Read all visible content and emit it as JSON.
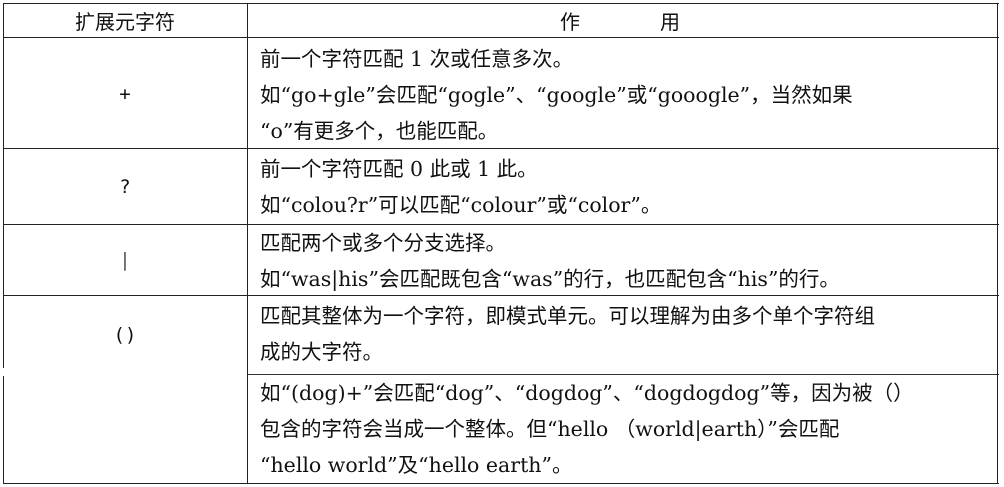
{
  "header": {
    "col1": "扩展元字符",
    "col2": "作　　　　用"
  },
  "rows": [
    {
      "symbol": "+",
      "lines": [
        "前一个字符匹配 1 次或任意多次。",
        "如“go+gle”会匹配“gogle”、“google”或“gooogle”，当然如果",
        "“o”有更多个，也能匹配。"
      ]
    },
    {
      "symbol": "?",
      "lines": [
        "前一个字符匹配 0 此或 1 此。",
        "如“colou?r”可以匹配“colour”或“color”。"
      ]
    },
    {
      "symbol": "|",
      "lines": [
        "匹配两个或多个分支选择。",
        "如“was|his”会匹配既包含“was”的行，也匹配包含“his”的行。"
      ]
    },
    {
      "symbol": "()",
      "lines": [
        "匹配其整体为一个字符，即模式单元。可以理解为由多个单个字符组",
        "成的大字符。"
      ]
    },
    {
      "symbol": "",
      "lines": [
        "如“(dog)+”会匹配“dog”、“dogdog”、“dogdogdog”等，因为被（）",
        "包含的字符会当成一个整体。但“hello （world|earth）”会匹配",
        "“hello world”及“hello earth”。"
      ]
    }
  ]
}
